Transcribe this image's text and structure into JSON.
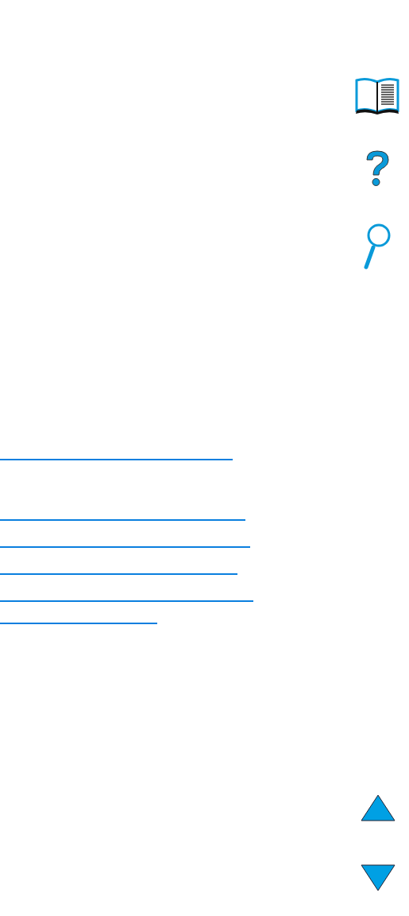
{
  "nav_buttons": [
    {
      "kind": "book"
    },
    {
      "kind": "help"
    },
    {
      "kind": "search"
    }
  ],
  "page_buttons": [
    {
      "kind": "up"
    },
    {
      "kind": "down"
    }
  ]
}
